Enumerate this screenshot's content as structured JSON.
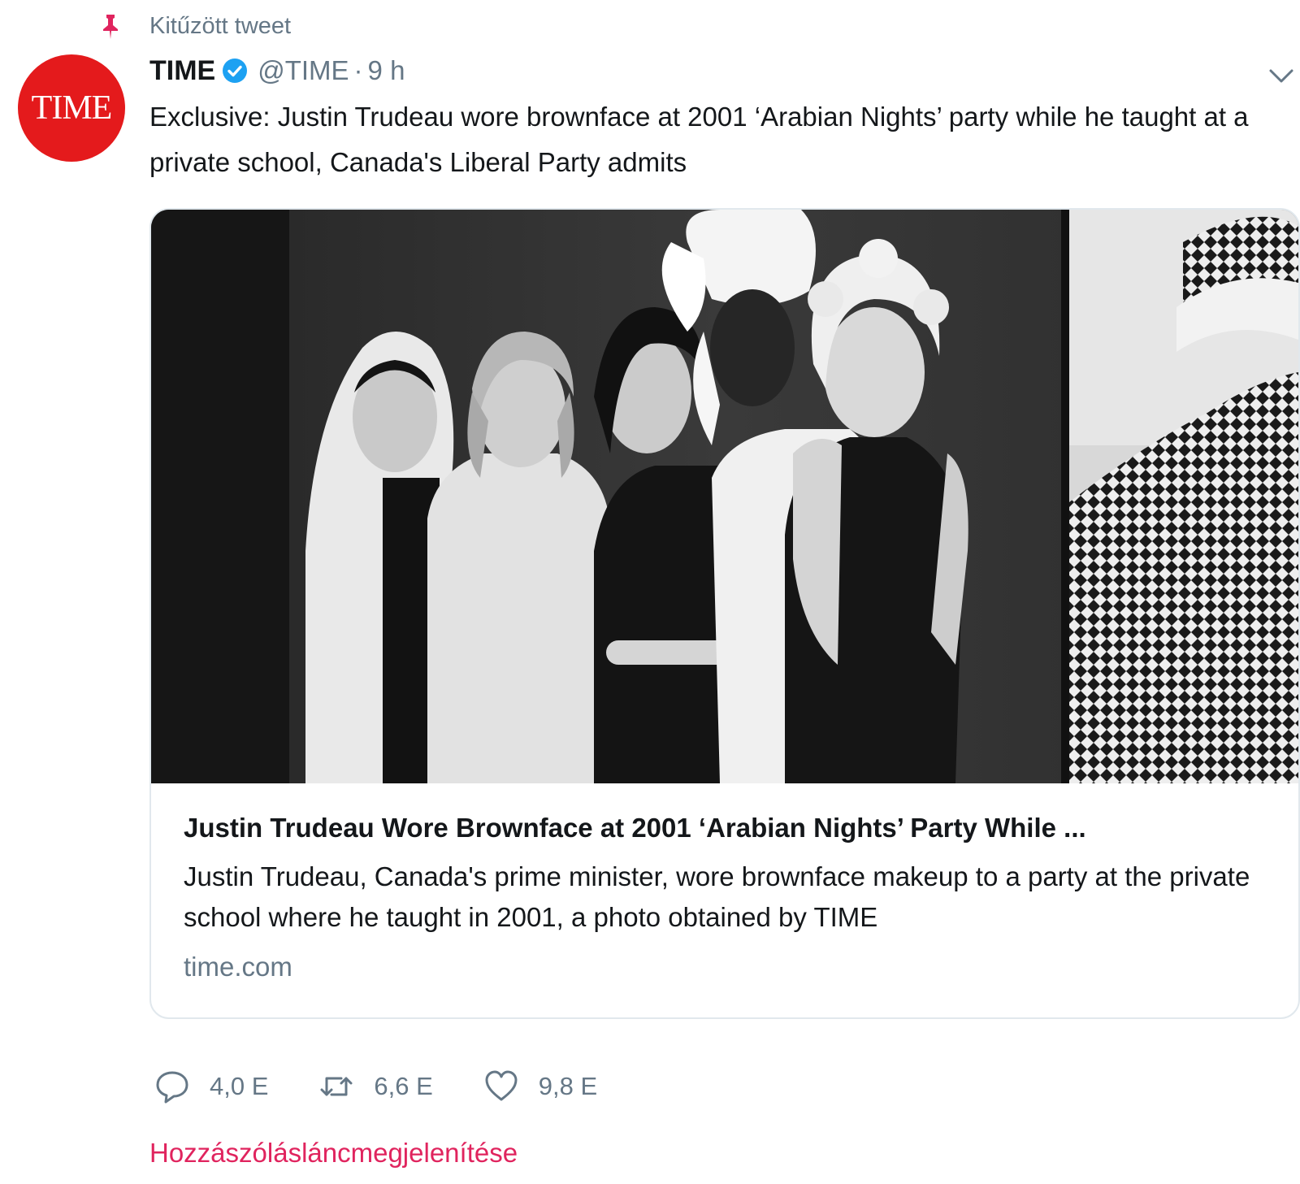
{
  "pinned": {
    "label": "Kitűzött tweet",
    "icon": "pin-icon"
  },
  "author": {
    "avatar_text": "TIME",
    "avatar_color": "#e41a1c",
    "display_name": "TIME",
    "verified": true,
    "handle": "@TIME",
    "separator": "·",
    "time": "9 h"
  },
  "tweet": {
    "text": "Exclusive: Justin Trudeau wore brownface at 2001 ‘Arabian Nights’ party while he taught at a private school, Canada's Liberal Party admits"
  },
  "card": {
    "image_alt": "Black-and-white photo of five people in costume at a party",
    "title": "Justin Trudeau Wore Brownface at 2001 ‘Arabian Nights’ Party While ...",
    "description": "Justin Trudeau, Canada's prime minister, wore brownface makeup to a party at the private school where he taught in 2001, a photo obtained by TIME",
    "domain": "time.com"
  },
  "actions": {
    "reply": {
      "icon": "reply-icon",
      "count": "4,0 E"
    },
    "retweet": {
      "icon": "retweet-icon",
      "count": "6,6 E"
    },
    "like": {
      "icon": "heart-icon",
      "count": "9,8 E"
    }
  },
  "thread_link": "Hozzászólásláncmegjelenítése",
  "colors": {
    "accent_link": "#e0245e",
    "secondary_text": "#657786",
    "verified_blue": "#1da1f2",
    "pin_red": "#e0245e"
  }
}
